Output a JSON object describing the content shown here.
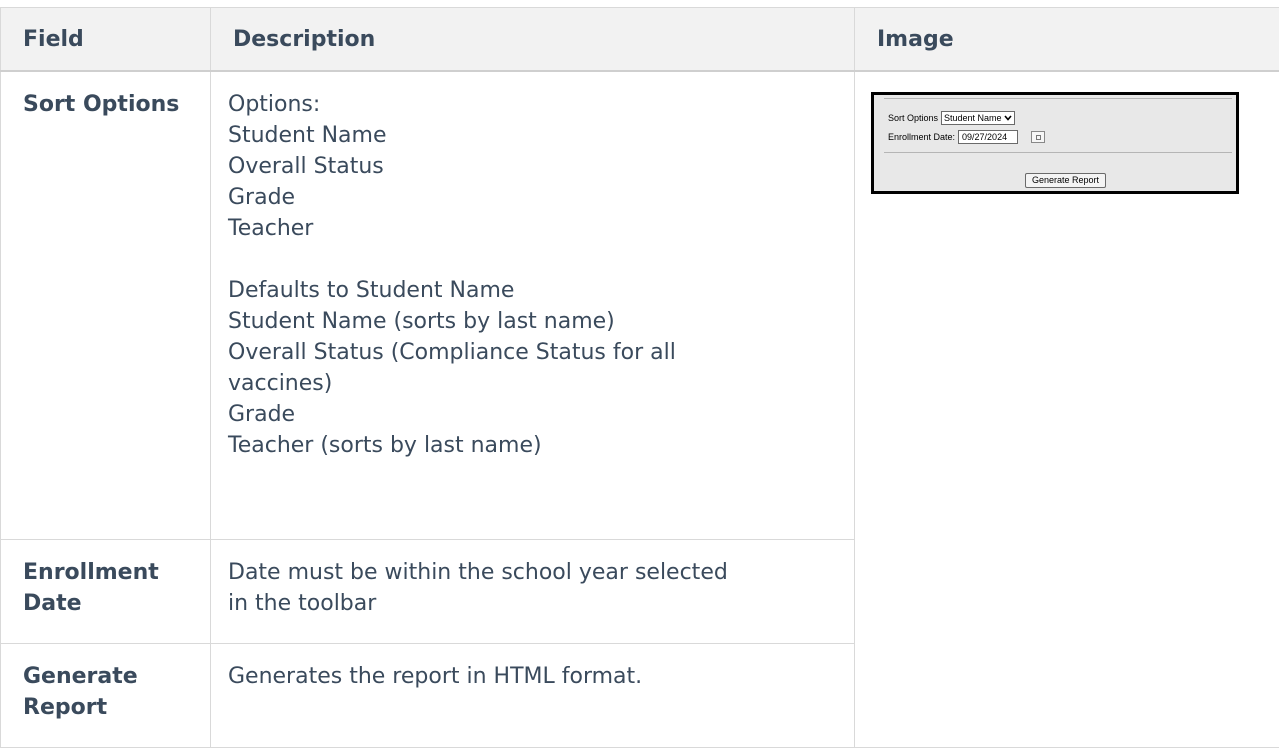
{
  "headers": {
    "field": "Field",
    "description": "Description",
    "image": "Image"
  },
  "rows": [
    {
      "field": "Sort Options",
      "desc_lines": [
        "Options:",
        "Student Name",
        "Overall Status",
        "Grade",
        "Teacher"
      ],
      "desc_lines2": [
        "Defaults to Student Name",
        "Student Name (sorts by last name)",
        "Overall Status (Compliance Status for all",
        "vaccines)",
        "Grade",
        "Teacher (sorts by last name)"
      ]
    },
    {
      "field": "Enrollment Date",
      "desc_lines": [
        "Date must be within the school year selected",
        "in the toolbar"
      ]
    },
    {
      "field": "Generate Report",
      "desc_lines": [
        "Generates the report in HTML format."
      ]
    }
  ],
  "screenshot": {
    "sort_label": "Sort Options",
    "sort_value": "Student Name",
    "enroll_label": "Enrollment Date:",
    "enroll_value": "09/27/2024",
    "generate_label": "Generate Report",
    "chevron_icon": "chevron-down-icon",
    "calendar_icon": "calendar-icon"
  }
}
